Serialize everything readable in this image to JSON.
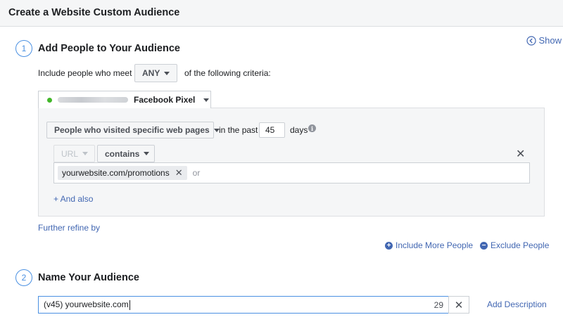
{
  "header": {
    "title": "Create a Website Custom Audience"
  },
  "show_link": {
    "label": "Show"
  },
  "step1": {
    "number": "1",
    "title": "Add People to Your Audience",
    "include_prefix": "Include people who meet",
    "match_selected": "ANY",
    "include_suffix": "of the following criteria:",
    "pixel": {
      "name": "Facebook Pixel",
      "status_color": "#42b72a"
    },
    "rule": {
      "event_selected": "People who visited specific web pages",
      "in_the_past_label": "in the past",
      "days_value": "45",
      "days_label": "days",
      "info_glyph": "i",
      "url_field": "URL",
      "operator": "contains",
      "token": "yourwebsite.com/promotions",
      "or_placeholder": "or",
      "and_also": "+ And also"
    },
    "further_refine": "Further refine by",
    "include_more": "Include More People",
    "exclude": "Exclude People"
  },
  "step2": {
    "number": "2",
    "title": "Name Your Audience",
    "name_value": "(v45) yourwebsite.com",
    "char_count": "29",
    "add_description": "Add Description"
  },
  "colors": {
    "accent": "#4267b2",
    "step_circle": "#4a90e2"
  }
}
